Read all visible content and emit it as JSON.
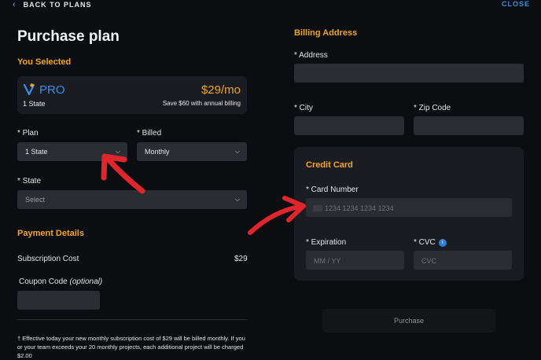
{
  "nav": {
    "back_label": "BACK TO PLANS",
    "close_label": "CLOSE"
  },
  "left": {
    "title": "Purchase plan",
    "you_selected_heading": "You Selected",
    "selected": {
      "plan_name": "PRO",
      "state_count": "1 State",
      "price": "$29/mo",
      "savings_note": "Save $60 with annual billing"
    },
    "plan_field": {
      "label": "* Plan",
      "value": "1 State"
    },
    "billed_field": {
      "label": "* Billed",
      "value": "Monthly"
    },
    "state_field": {
      "label": "* State",
      "value": "Select"
    },
    "payment_heading": "Payment Details",
    "subscription_label": "Subscription Cost",
    "subscription_value": "$29",
    "coupon_label": "Coupon Code",
    "coupon_optional": "(optional)",
    "footnote": "† Effective today your new monthly subscription cost of $29 will be billed monthly. If you or your team exceeds your 20 monthly projects, each additional project will be charged $2.00"
  },
  "right": {
    "billing_heading": "Billing Address",
    "address_label": "* Address",
    "city_label": "* City",
    "zip_label": "* Zip Code",
    "card_heading": "Credit Card",
    "card_number_label": "* Card Number",
    "card_number_placeholder": "1234 1234 1234 1234",
    "expiration_label": "* Expiration",
    "expiration_placeholder": "MM / YY",
    "cvc_label": "* CVC",
    "cvc_placeholder": "CVC",
    "purchase_label": "Purchase"
  },
  "colors": {
    "accent_orange": "#f0a526",
    "accent_blue": "#3b8fe6",
    "annotation_red": "#e0262d",
    "background": "#0c0d10"
  },
  "icons": [
    "chevron-left-icon",
    "pro-badge-icon",
    "chevron-down-icon",
    "info-icon",
    "card-icon",
    "red-arrow-annotation"
  ]
}
